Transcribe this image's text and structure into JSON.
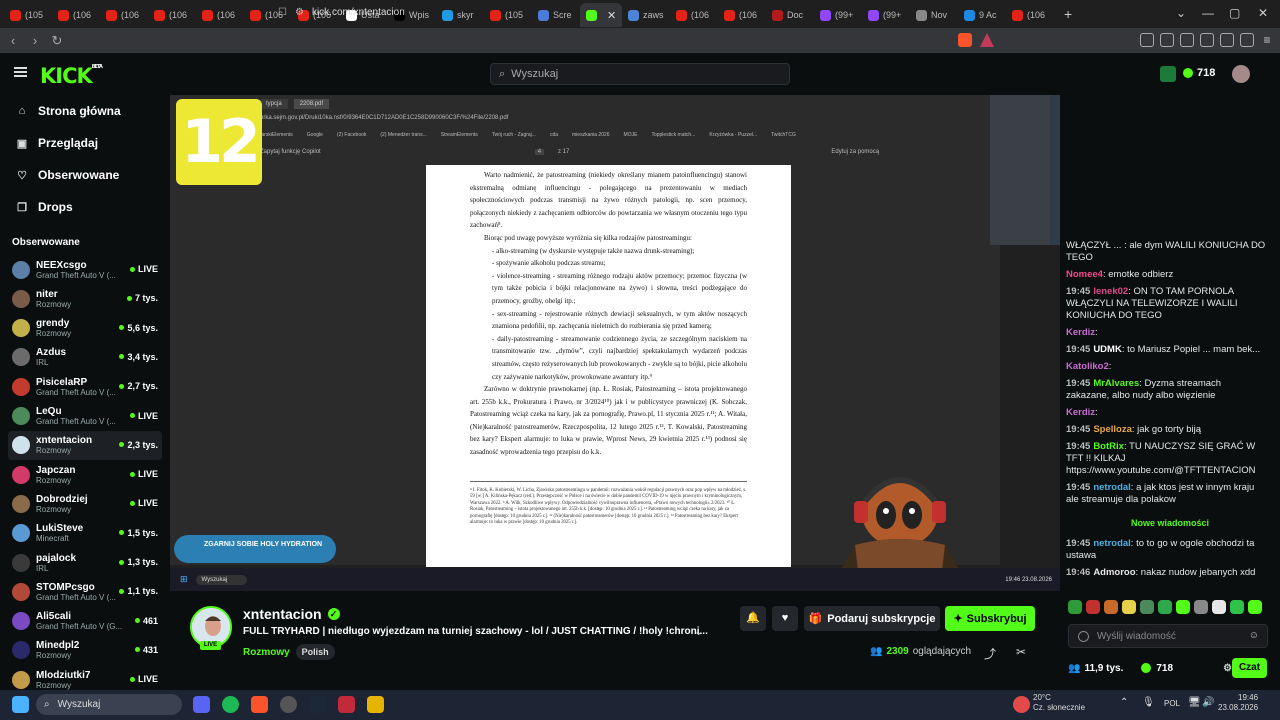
{
  "browser": {
    "tabs": [
      {
        "label": "(105",
        "color": "#e62117"
      },
      {
        "label": "(106",
        "color": "#e62117"
      },
      {
        "label": "(106",
        "color": "#e62117"
      },
      {
        "label": "(106",
        "color": "#e62117"
      },
      {
        "label": "(106",
        "color": "#e62117"
      },
      {
        "label": "(106",
        "color": "#e62117"
      },
      {
        "label": "(106",
        "color": "#e62117"
      },
      {
        "label": "Usta",
        "color": "#ffffff"
      },
      {
        "label": "Wpis",
        "color": "#000000"
      },
      {
        "label": "skyr",
        "color": "#1e9be5"
      },
      {
        "label": "(105",
        "color": "#e62117"
      },
      {
        "label": "Scre",
        "color": "#4b7bd6"
      },
      {
        "label": "",
        "color": "#53fc18"
      },
      {
        "label": "zaws",
        "color": "#4b84d6"
      },
      {
        "label": "(106",
        "color": "#e62117"
      },
      {
        "label": "(106",
        "color": "#e62117"
      },
      {
        "label": "Doc",
        "color": "#b31b1b"
      },
      {
        "label": "(99+",
        "color": "#9146ff"
      },
      {
        "label": "(99+",
        "color": "#9146ff"
      },
      {
        "label": "Nov",
        "color": "#888888"
      },
      {
        "label": "9 Ac",
        "color": "#1e88e5"
      },
      {
        "label": "(106",
        "color": "#e62117"
      }
    ],
    "url": "kick.com/xntentacion"
  },
  "kick": {
    "search_placeholder": "Wyszukaj",
    "points": "718"
  },
  "sidebar": {
    "nav": [
      {
        "label": "Strona główna",
        "icon": "home-icon",
        "glyph": "⌂"
      },
      {
        "label": "Przeglądaj",
        "icon": "browse-icon",
        "glyph": "▣"
      },
      {
        "label": "Obserwowane",
        "icon": "heart-icon",
        "glyph": "♡"
      },
      {
        "label": "Drops",
        "icon": "drops-icon",
        "glyph": "❒"
      }
    ],
    "followed_title": "Obserwowane",
    "channels": [
      {
        "name": "NEEXcsgo",
        "game": "Grand Theft Auto V (...",
        "viewers": "LIVE",
        "color": "#5b7fa6"
      },
      {
        "name": "niter",
        "game": "Rozmowy",
        "viewers": "7 tys.",
        "color": "#7a5b4a"
      },
      {
        "name": "grendy",
        "game": "Rozmowy",
        "viewers": "5,6 tys.",
        "color": "#c4b04a"
      },
      {
        "name": "Azdus",
        "game": "IRL",
        "viewers": "3,4 tys.",
        "color": "#6b6b6b"
      },
      {
        "name": "PisicelaRP",
        "game": "Grand Theft Auto V (...",
        "viewers": "2,7 tys.",
        "color": "#c23b2e"
      },
      {
        "name": "LeQu",
        "game": "Grand Theft Auto V (...",
        "viewers": "LIVE",
        "color": "#4a8a5b"
      },
      {
        "name": "xntentacion",
        "game": "Rozmowy",
        "viewers": "2,3 tys.",
        "color": "#cfe1ea"
      },
      {
        "name": "Japczan",
        "game": "Rozmowy",
        "viewers": "LIVE",
        "color": "#d23a6a"
      },
      {
        "name": "Dobrodziej",
        "game": "Rozmowy",
        "viewers": "LIVE",
        "color": "#8a6a4a"
      },
      {
        "name": "LukiSteve",
        "game": "Minecraft",
        "viewers": "1,5 tys.",
        "color": "#5a9ad2"
      },
      {
        "name": "pajalock",
        "game": "IRL",
        "viewers": "1,3 tys.",
        "color": "#3a3a3a"
      },
      {
        "name": "STOMPcsgo",
        "game": "Grand Theft Auto V (...",
        "viewers": "1,1 tys.",
        "color": "#b24a3a"
      },
      {
        "name": "Ali5cali",
        "game": "Grand Theft Auto V (G...",
        "viewers": "461",
        "color": "#7a4ac2"
      },
      {
        "name": "Minedpl2",
        "game": "Rozmowy",
        "viewers": "431",
        "color": "#2a2a6a"
      },
      {
        "name": "Mlodziutki7",
        "game": "Rozmowy",
        "viewers": "LIVE",
        "color": "#c29a4a"
      }
    ]
  },
  "stream": {
    "badge_number": "12",
    "inner_tabs": [
      "typcja",
      "2208.pdf"
    ],
    "inner_url": "orka.sejm.gov.pl/Druki10ka.nsf/0/9364E0C1D712AD0E1C258D990060C3F/%24File/2208.pdf",
    "inner_bookmarks": [
      "tarskiElements",
      "Google",
      "(2) Facebook",
      "(2) Menedżer trans...",
      "StreamElements",
      "Twój ruch - Zagraj...",
      "cda",
      "mieszkania 2026",
      "MOJE",
      "Topplestick match...",
      "Krzyżówka - Puzzel...",
      "TwitchTCG"
    ],
    "inner_toolbar": [
      "Zapytaj funkcję Copilot",
      "4",
      "z 17",
      "Edytuj za pomocą"
    ],
    "pdf_paragraphs": [
      {
        "cls": "",
        "text": "Warto nadmienić, że patostreaming (niekiedy określany mianem patoinfluencingu) stanowi ekstremalną odmianę influencingu - polegającego na prezentowaniu w mediach społecznościowych podczas transmisji na żywo różnych patologii, np. scen przemocy, połączonych niekiedy z zachęcaniem odbiorców do powtarzania we własnym otoczeniu tego typu zachowań⁸."
      },
      {
        "cls": "",
        "text": "Biorąc pod uwagę powyższe wyróżnia się kilka rodzajów patostreamingu:"
      },
      {
        "cls": "li",
        "text": "- alko-streaming (w dyskursie występuje także nazwa drunk-streaming);"
      },
      {
        "cls": "li",
        "text": "- spożywanie alkoholu podczas streamu;"
      },
      {
        "cls": "li",
        "text": "- violence-streaming - streaming różnego rodzaju aktów przemocy; przemoc fizyczna (w tym także pobicia i bójki relacjonowane na żywo) i słowna, treści podżegające do przemocy, groźby, obelgi itp.;"
      },
      {
        "cls": "li",
        "text": "- sex-streaming - rejestrowanie różnych dewiacji seksualnych, w tym aktów noszących znamiona pedofilii, np. zachęcania nieletnich do rozbierania się przed kamerą;"
      },
      {
        "cls": "li",
        "text": "- daily-patostreaming - streamowanie codziennego życia, ze szczególnym naciskiem na transmitowanie tzw. „dymów”, czyli najbardziej spektakularnych wydarzeń podczas streamów, często reżyserowanych lub prowokowanych - zwykle są to bójki, picie alkoholu czy zażywanie narkotyków, prowokowane awantury itp.⁹"
      },
      {
        "cls": "",
        "text": "Zarówno w doktrynie prawnokarnej (np. Ł. Rosiak, Patostreaming – istota projektowanego art. 255b k.k., Prokuratura i Prawo, nr 3/2024¹⁰) jak i w publicystyce prawniczej (K. Sobczak, Patostreaming wciąż czeka na kary, jak za pornografię, Prawo.pl, 11 stycznia 2025 r.¹¹; A. Witała, (Nie)karalność patostreamerów, Rzeczpospolita, 12 lutego 2025 r.¹², T. Kowalski, Patostreaming bez kary? Ekspert alarmuje: to luka w prawie, Wprost News, 29 kwietnia 2025 r.¹³) podnosi się zasadność wprowadzenia tego przepisu do k.k."
      }
    ],
    "pdf_footnotes": "⁸ I. Fitok, K. Kobierski, W. Licha, Zjawisko patostreamingu w pandemii: rozważania wokół regulacji prawnych oraz pop wpływ na młodzież, s. 59 [w:] A. Kilińska-Pękacz (red.), Przestępczość w Polsce i na świecie w dobie pandemii COVID-19 w ujęciu prawnym i kryminologicznym, Warszawa 2022. ⁹ A. Wilk, Szkodliwe wpływy. Odpowiedzialność cywilnoprawna influencera, »Prawo nowych technologii« 2/2023. ¹⁰ Ł. Rosiak, Patostreaming – istota projektowanego art. 255b k.k. [dostęp: 10 grudnia 2025 r.]. ¹¹ Patostreaming wciąż czeka na kary, jak za pornografię [dostęp: 10 grudnia 2025 r.]. ¹² (Nie)karalność patostreamerów [dostęp: 10 grudnia 2025 r.]. ¹³ Patostreaming bez kary? Ekspert alarmuje: to luka w prawie [dostęp: 10 grudnia 2025 r.].",
    "promo_text": "ZGARNIJ SOBIE HOLY HYDRATION",
    "win_search": "Wyszukaj",
    "win_clock": "19:46 23.08.2026"
  },
  "chat": {
    "messages": [
      {
        "time": "",
        "user": "",
        "color": "#e04a8a",
        "text": "WŁĄCZYŁ ... : ale dym WALILI KONIUCHA DO TEGO"
      },
      {
        "time": "",
        "user": "Nomee4",
        "color": "#f04a8a",
        "text": ": emotke odbierz"
      },
      {
        "time": "19:45",
        "user": "lenek02",
        "color": "#e04a8a",
        "text": ": ON TO TAM PORNOLA WŁĄCZYLI NA TELEWIZORZE I WALILI KONIUCHA DO TEGO"
      },
      {
        "time": "",
        "user": "Kerdiz",
        "color": "#c86ad2",
        "text": ":"
      },
      {
        "time": "19:45",
        "user": "UDMK",
        "color": "#ffffff",
        "text": ": to Mariusz Popiel ... mam bek..."
      },
      {
        "time": "",
        "user": "Katoliko2",
        "color": "#c86ad2",
        "text": ":"
      },
      {
        "time": "19:45",
        "user": "MrAlvares",
        "color": "#53fc18",
        "text": ": Dyzma streamach zakazane, albo nudy albo więzienie"
      },
      {
        "time": "",
        "user": "Kerdiz",
        "color": "#c86ad2",
        "text": ":"
      },
      {
        "time": "19:45",
        "user": "Spelloza",
        "color": "#e6a84a",
        "text": ": jak go torty biją"
      },
      {
        "time": "19:45",
        "user": "BotRix",
        "color": "#53fc18",
        "text": ": TU NAUCZYSZ SIĘ GRAĆ W TFT !! KILKAJ https://www.youtube.com/@TFTTENTACION"
      },
      {
        "time": "19:45",
        "user": "netrodal",
        "color": "#4ab2e6",
        "text": ": a jak ktos jest w innym kraju ale streamuje dla polakow"
      }
    ],
    "new_messages": "Nowe wiadomości",
    "messages_after": [
      {
        "time": "19:45",
        "user": "netrodal",
        "color": "#4ab2e6",
        "text": ": to to go w ogole obchodzi ta ustawa"
      },
      {
        "time": "19:46",
        "user": "Admoroo",
        "color": "#e6e6e6",
        "text": ": nakaz nudow jebanych xdd"
      }
    ],
    "input_placeholder": "Wyślij wiadomość",
    "followers": "11,9 tys.",
    "points": "718",
    "send_label": "Czat"
  },
  "info": {
    "name": "xntentacion",
    "title": "FULL TRYHARD | niedługo wyjezdzam na turniej szachowy - lol / JUST CHATTING / !holy !chroni...",
    "category": "Rozmowy",
    "tag": "Polish",
    "live": "LIVE",
    "gift_label": "Podaruj subskrypcje",
    "sub_label": "Subskrybuj",
    "viewers": "2309",
    "viewers_label": "oglądających"
  },
  "taskbar": {
    "search": "Wyszukaj",
    "temp": "20°C",
    "weather": "Cz. słonecznie",
    "lang": "POL",
    "time": "19:46",
    "date": "23.08.2026"
  }
}
